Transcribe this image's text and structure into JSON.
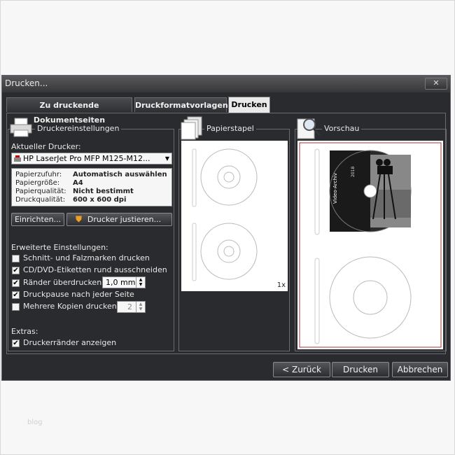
{
  "window": {
    "title": "Drucken...",
    "close": "✕"
  },
  "tabs": [
    {
      "label": "Zu druckende Dokumentseiten"
    },
    {
      "label": "Druckformatvorlagen"
    },
    {
      "label": "Drucken"
    }
  ],
  "printer_settings": {
    "title": "Druckereinstellungen",
    "current_printer_label": "Aktueller Drucker:",
    "printer_name": "HP LaserJet Pro MFP M125-M12...",
    "info": [
      {
        "key": "Papierzufuhr:",
        "value": "Automatisch auswählen"
      },
      {
        "key": "Papiergröße:",
        "value": "A4"
      },
      {
        "key": "Papierqualität:",
        "value": "Nicht bestimmt"
      },
      {
        "key": "Druckqualität:",
        "value": "600 x 600 dpi"
      }
    ],
    "setup_button": "Einrichten...",
    "adjust_button": "Drucker justieren...",
    "advanced_label": "Erweiterte Einstellungen:",
    "options": [
      {
        "label": "Schnitt- und Falzmarken drucken",
        "checked": false
      },
      {
        "label": "CD/DVD-Etiketten rund ausschneiden",
        "checked": true
      },
      {
        "label": "Ränder überdrucken",
        "checked": true
      },
      {
        "label": "Druckpause nach jeder Seite",
        "checked": true
      },
      {
        "label": "Mehrere Kopien drucken",
        "checked": false
      }
    ],
    "margin_value": "1,0 mm",
    "copies_value": "2",
    "extras_label": "Extras:",
    "extras_option": {
      "label": "Druckerränder anzeigen",
      "checked": true
    }
  },
  "paper_stack": {
    "title": "Papierstapel",
    "count": "1x"
  },
  "preview": {
    "title": "Vorschau",
    "disc_year": "2018",
    "disc_label": "Video-Archiv"
  },
  "footer": {
    "back": "< Zurück",
    "print": "Drucken",
    "cancel": "Abbrechen"
  },
  "watermark": "blog",
  "colors": {
    "dialog_bg": "#2a2b2e",
    "titlebar": "#444448",
    "active_tab": "#e9e9e9"
  }
}
